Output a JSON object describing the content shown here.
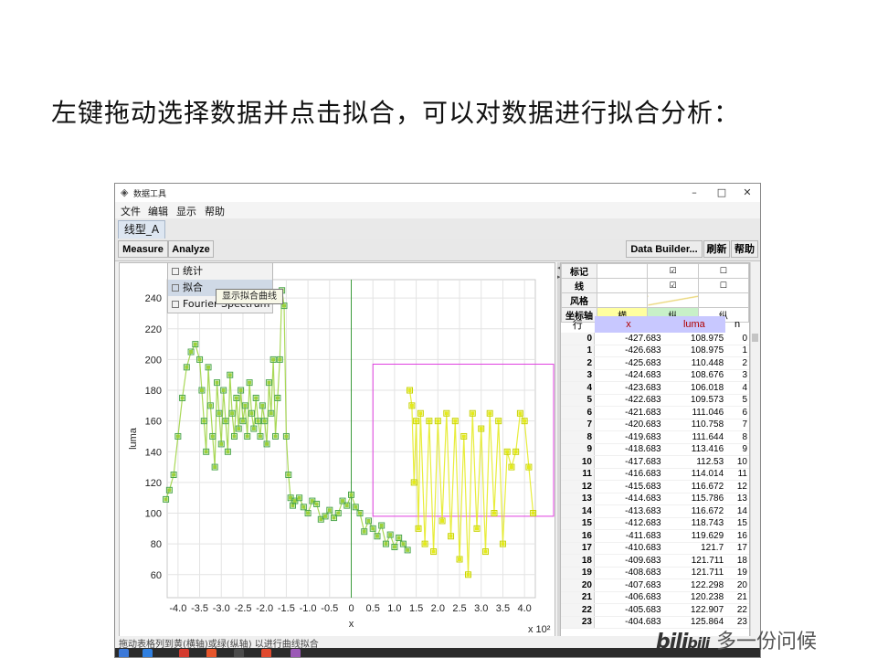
{
  "slide": {
    "heading": "左键拖动选择数据并点击拟合，可以对数据进行拟合分析："
  },
  "window": {
    "title": "数据工具",
    "controls": {
      "minimize": "–",
      "maximize": "□",
      "close": "✕"
    },
    "menu": [
      "文件",
      "编辑",
      "显示",
      "帮助"
    ],
    "tab": "线型_A",
    "toolbar": {
      "measure": "Measure",
      "analyze": "Analyze",
      "data_builder": "Data Builder...",
      "refresh": "刷新",
      "help": "帮助"
    },
    "analyze_menu": [
      "统计",
      "拟合",
      "Fourier Spectrum"
    ],
    "tooltip": "显示拟合曲线",
    "status": "拖动表格列到黄(横轴)或绿(纵轴) 以进行曲线拟合"
  },
  "props_table": {
    "rows": [
      {
        "label": "标记",
        "x": "",
        "luma": "☑",
        "n": "☐"
      },
      {
        "label": "线",
        "x": "",
        "luma": "☑",
        "n": "☐"
      },
      {
        "label": "风格",
        "x": "",
        "luma": "",
        "n": ""
      },
      {
        "label": "坐标轴",
        "x": "横",
        "luma": "纵",
        "n": "纵"
      }
    ],
    "axis_colors": {
      "x": "#ffffa0",
      "luma": "#c8f0c8",
      "n": "#ffffff"
    }
  },
  "data_table": {
    "headers": [
      "行",
      "x",
      "luma",
      "n"
    ],
    "header_colors": {
      "x": "#c8c8ff",
      "luma": "#c8c8ff"
    },
    "rows": [
      [
        "0",
        "-427.683",
        "108.975",
        "0"
      ],
      [
        "1",
        "-426.683",
        "108.975",
        "1"
      ],
      [
        "2",
        "-425.683",
        "110.448",
        "2"
      ],
      [
        "3",
        "-424.683",
        "108.676",
        "3"
      ],
      [
        "4",
        "-423.683",
        "106.018",
        "4"
      ],
      [
        "5",
        "-422.683",
        "109.573",
        "5"
      ],
      [
        "6",
        "-421.683",
        "111.046",
        "6"
      ],
      [
        "7",
        "-420.683",
        "110.758",
        "7"
      ],
      [
        "8",
        "-419.683",
        "111.644",
        "8"
      ],
      [
        "9",
        "-418.683",
        "113.416",
        "9"
      ],
      [
        "10",
        "-417.683",
        "112.53",
        "10"
      ],
      [
        "11",
        "-416.683",
        "114.014",
        "11"
      ],
      [
        "12",
        "-415.683",
        "116.672",
        "12"
      ],
      [
        "13",
        "-414.683",
        "115.786",
        "13"
      ],
      [
        "14",
        "-413.683",
        "116.672",
        "14"
      ],
      [
        "15",
        "-412.683",
        "118.743",
        "15"
      ],
      [
        "16",
        "-411.683",
        "119.629",
        "16"
      ],
      [
        "17",
        "-410.683",
        "121.7",
        "17"
      ],
      [
        "18",
        "-409.683",
        "121.711",
        "18"
      ],
      [
        "19",
        "-408.683",
        "121.711",
        "19"
      ],
      [
        "20",
        "-407.683",
        "122.298",
        "20"
      ],
      [
        "21",
        "-406.683",
        "120.238",
        "21"
      ],
      [
        "22",
        "-405.683",
        "122.907",
        "22"
      ],
      [
        "23",
        "-404.683",
        "125.864",
        "23"
      ]
    ]
  },
  "chart_data": {
    "type": "scatter",
    "xlabel": "x",
    "ylabel": "luma",
    "x_multiplier_label": "x 10²",
    "xlim": [
      -4.25,
      4.25
    ],
    "ylim": [
      45,
      252
    ],
    "xticks": [
      "-4.0",
      "-3.5",
      "-3.0",
      "-2.5",
      "-2.0",
      "-1.5",
      "-1.0",
      "-0.5",
      "0",
      "0.5",
      "1.0",
      "1.5",
      "2.0",
      "2.5",
      "3.0",
      "3.5",
      "4.0"
    ],
    "yticks": [
      "60",
      "80",
      "100",
      "120",
      "140",
      "160",
      "180",
      "200",
      "220",
      "240"
    ],
    "grid": true,
    "series": [
      {
        "color": "#9ad13a",
        "x": [
          -4.28,
          -4.2,
          -4.1,
          -4.0,
          -3.9,
          -3.8,
          -3.7,
          -3.6,
          -3.5,
          -3.45,
          -3.4,
          -3.35,
          -3.3,
          -3.25,
          -3.2,
          -3.15,
          -3.1,
          -3.05,
          -3.0,
          -2.95,
          -2.9,
          -2.85,
          -2.8,
          -2.75,
          -2.7,
          -2.65,
          -2.6,
          -2.55,
          -2.5,
          -2.45,
          -2.4,
          -2.35,
          -2.3,
          -2.25,
          -2.2,
          -2.15,
          -2.1,
          -2.05,
          -2.0,
          -1.95,
          -1.9,
          -1.85,
          -1.8,
          -1.75,
          -1.7,
          -1.65,
          -1.6,
          -1.55,
          -1.5,
          -1.45,
          -1.4,
          -1.35,
          -1.3,
          -1.2,
          -1.1,
          -1.0,
          -0.9,
          -0.8,
          -0.7,
          -0.6,
          -0.5,
          -0.4,
          -0.3,
          -0.2,
          -0.1,
          0.0,
          0.1,
          0.2,
          0.3,
          0.4,
          0.5,
          0.6,
          0.7,
          0.8,
          0.9,
          1.0,
          1.1,
          1.2,
          1.3
        ],
        "y": [
          109,
          115,
          125,
          150,
          175,
          195,
          205,
          210,
          200,
          180,
          160,
          140,
          195,
          170,
          150,
          130,
          185,
          165,
          145,
          180,
          160,
          140,
          190,
          165,
          150,
          175,
          155,
          180,
          160,
          170,
          150,
          185,
          165,
          155,
          175,
          160,
          150,
          170,
          160,
          145,
          185,
          165,
          200,
          150,
          175,
          200,
          245,
          235,
          150,
          125,
          110,
          105,
          108,
          110,
          104,
          100,
          108,
          106,
          96,
          98,
          102,
          97,
          100,
          108,
          105,
          112,
          104,
          100,
          88,
          95,
          90,
          85,
          92,
          80,
          86,
          78,
          84,
          80,
          76
        ]
      },
      {
        "color": "#e4ea1a",
        "x": [
          1.35,
          1.4,
          1.45,
          1.5,
          1.55,
          1.6,
          1.7,
          1.8,
          1.9,
          2.0,
          2.1,
          2.2,
          2.3,
          2.4,
          2.5,
          2.6,
          2.7,
          2.8,
          2.9,
          3.0,
          3.1,
          3.2,
          3.3,
          3.4,
          3.5,
          3.6,
          3.7,
          3.8,
          3.9,
          4.0,
          4.1,
          4.2
        ],
        "y": [
          180,
          170,
          120,
          160,
          90,
          165,
          80,
          160,
          75,
          160,
          95,
          165,
          85,
          160,
          70,
          150,
          60,
          165,
          90,
          155,
          75,
          165,
          100,
          160,
          80,
          140,
          130,
          140,
          165,
          160,
          130,
          100
        ]
      }
    ]
  }
}
